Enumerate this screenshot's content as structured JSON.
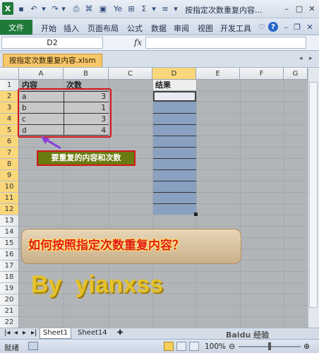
{
  "window": {
    "title": "按指定次数重复内容...",
    "app_icon": "excel-logo",
    "accent_color": "#1f7a3a"
  },
  "ribbon": {
    "file_tab": "文件",
    "tabs": [
      "开始",
      "插入",
      "页面布局",
      "公式",
      "数据",
      "审阅",
      "视图",
      "开发工具"
    ]
  },
  "formula_bar": {
    "name_box": "D2",
    "fx_label": "fx",
    "value": ""
  },
  "workbook_tab": "按指定次数重复内容.xlsm",
  "grid": {
    "columns": [
      "A",
      "B",
      "C",
      "D",
      "E",
      "F",
      "G"
    ],
    "selected_column": "D",
    "rows": [
      "1",
      "2",
      "3",
      "4",
      "5",
      "6",
      "7",
      "8",
      "9",
      "10",
      "11",
      "12",
      "13",
      "14",
      "15",
      "16",
      "17",
      "18",
      "19",
      "20",
      "21",
      "22"
    ],
    "header_content": "内容",
    "header_count": "次数",
    "header_result": "结果",
    "data": [
      {
        "content": "a",
        "count": "3"
      },
      {
        "content": "b",
        "count": "1"
      },
      {
        "content": "c",
        "count": "3"
      },
      {
        "content": "d",
        "count": "4"
      }
    ],
    "result_fill_color": "#8aa0c0",
    "highlight_border_color": "#d21818"
  },
  "annotations": {
    "callout": "要重复的内容和次数",
    "banner": "如何按照指定次数重复内容？",
    "byline": "By  yianxss"
  },
  "sheets": {
    "tabs": [
      "Sheet1",
      "Sheet14"
    ],
    "active": "Sheet1"
  },
  "status": {
    "mode": "就绪",
    "zoom": "100%"
  },
  "watermark": "Baidu 经验"
}
